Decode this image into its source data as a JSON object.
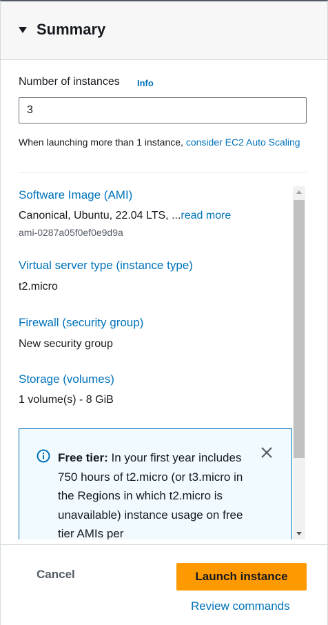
{
  "summary": {
    "title": "Summary"
  },
  "instances": {
    "label": "Number of instances",
    "info_label": "Info",
    "value": "3",
    "hint_prefix": "When launching more than 1 instance,",
    "hint_link": "consider EC2 Auto Scaling"
  },
  "details": {
    "ami": {
      "label": "Software Image (AMI)",
      "value": "Canonical, Ubuntu, 22.04 LTS, ...",
      "read_more": "read more",
      "id": "ami-0287a05f0ef0e9d9a"
    },
    "instance_type": {
      "label": "Virtual server type (instance type)",
      "value": "t2.micro"
    },
    "firewall": {
      "label": "Firewall (security group)",
      "value": "New security group"
    },
    "storage": {
      "label": "Storage (volumes)",
      "value": "1 volume(s) - 8 GiB"
    }
  },
  "free_tier": {
    "title": "Free tier:",
    "text": "In your first year includes 750 hours of t2.micro (or t3.micro in the Regions in which t2.micro is unavailable) instance usage on free tier AMIs per",
    "icon": "info-circle-icon"
  },
  "footer": {
    "cancel_label": "Cancel",
    "launch_label": "Launch instance",
    "review_label": "Review commands"
  },
  "colors": {
    "link": "#0073bb",
    "primary_button": "#ff9900",
    "alert_bg": "#f1faff"
  }
}
